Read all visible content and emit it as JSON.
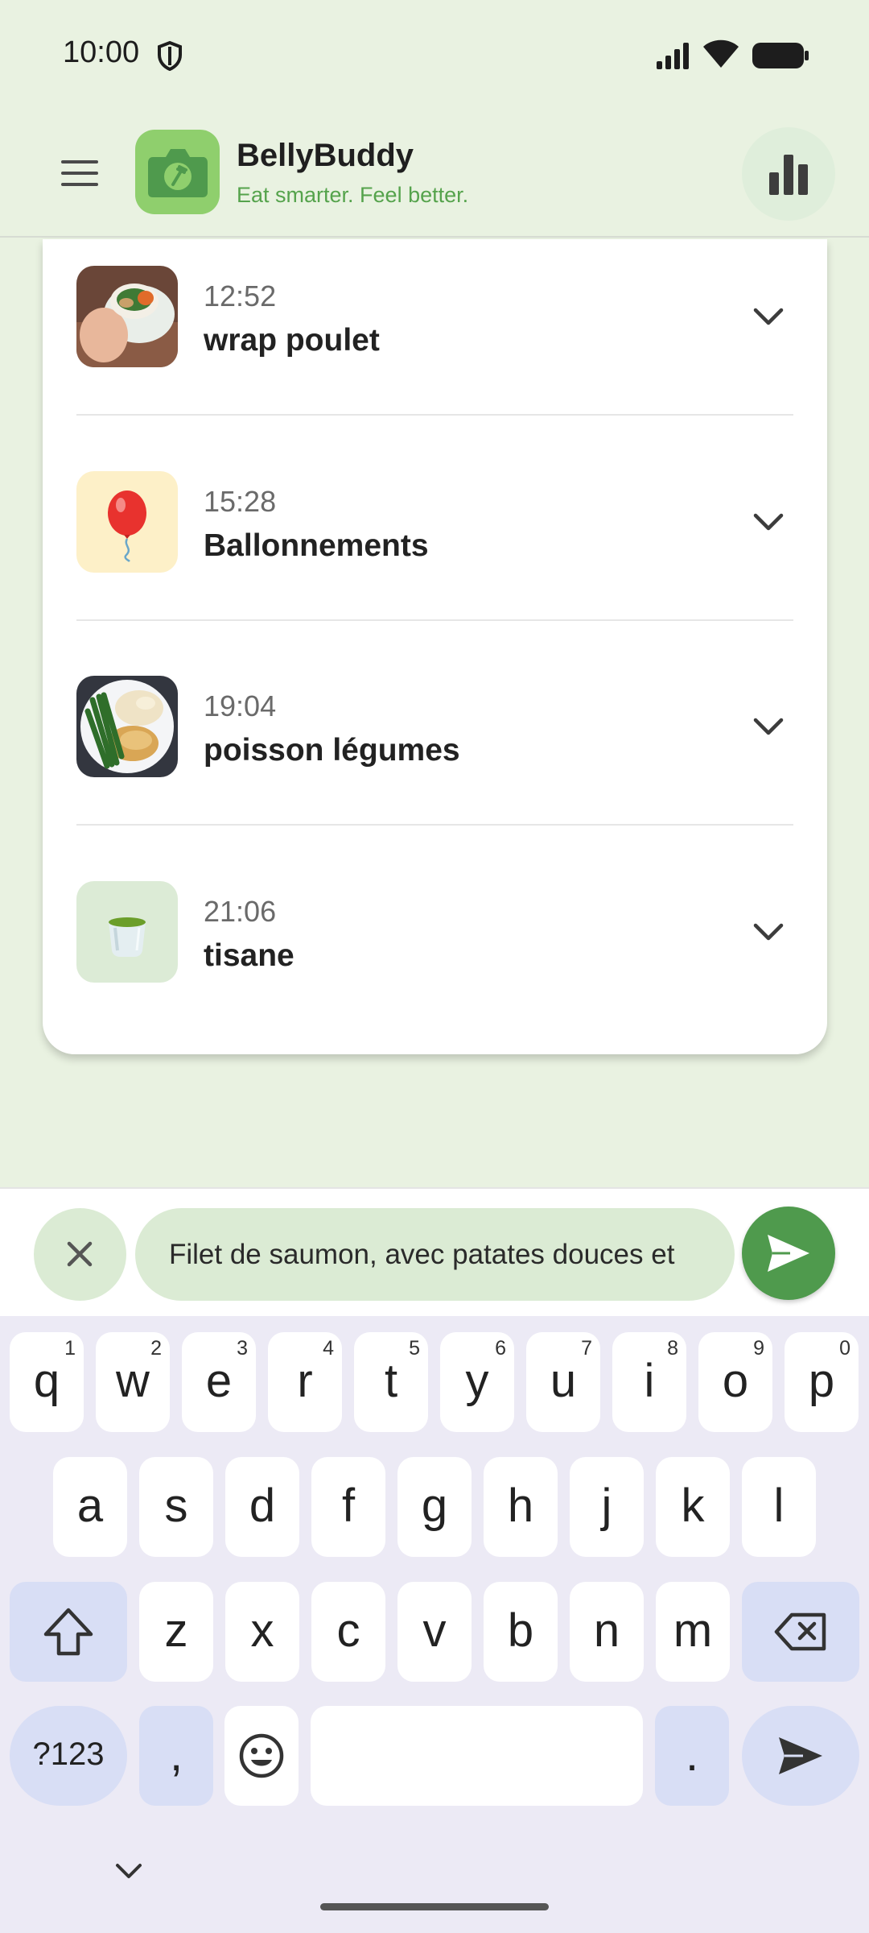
{
  "status_bar": {
    "time": "10:00"
  },
  "app_bar": {
    "title": "BellyBuddy",
    "subtitle": "Eat smarter. Feel better."
  },
  "entries": [
    {
      "time": "12:52",
      "name": "wrap poulet",
      "thumb": "wrap-photo"
    },
    {
      "time": "15:28",
      "name": "Ballonnements",
      "thumb": "balloon-emoji"
    },
    {
      "time": "19:04",
      "name": "poisson légumes",
      "thumb": "fish-plate-photo"
    },
    {
      "time": "21:06",
      "name": "tisane",
      "thumb": "tea-cup-emoji"
    }
  ],
  "composer": {
    "input_value": "Filet de saumon, avec patates douces et"
  },
  "keyboard": {
    "row1": [
      {
        "k": "q",
        "h": "1"
      },
      {
        "k": "w",
        "h": "2"
      },
      {
        "k": "e",
        "h": "3"
      },
      {
        "k": "r",
        "h": "4"
      },
      {
        "k": "t",
        "h": "5"
      },
      {
        "k": "y",
        "h": "6"
      },
      {
        "k": "u",
        "h": "7"
      },
      {
        "k": "i",
        "h": "8"
      },
      {
        "k": "o",
        "h": "9"
      },
      {
        "k": "p",
        "h": "0"
      }
    ],
    "row2": [
      "a",
      "s",
      "d",
      "f",
      "g",
      "h",
      "j",
      "k",
      "l"
    ],
    "row3": [
      "z",
      "x",
      "c",
      "v",
      "b",
      "n",
      "m"
    ],
    "symbols_label": "?123",
    "comma": ",",
    "period": "."
  },
  "colors": {
    "background": "#e9f2e1",
    "brand_green": "#4f9a4d",
    "subtitle_green": "#55a34c",
    "chip_green": "#dbebd4",
    "keyboard_bg": "#eceaf5",
    "modifier_key": "#d8def5"
  }
}
